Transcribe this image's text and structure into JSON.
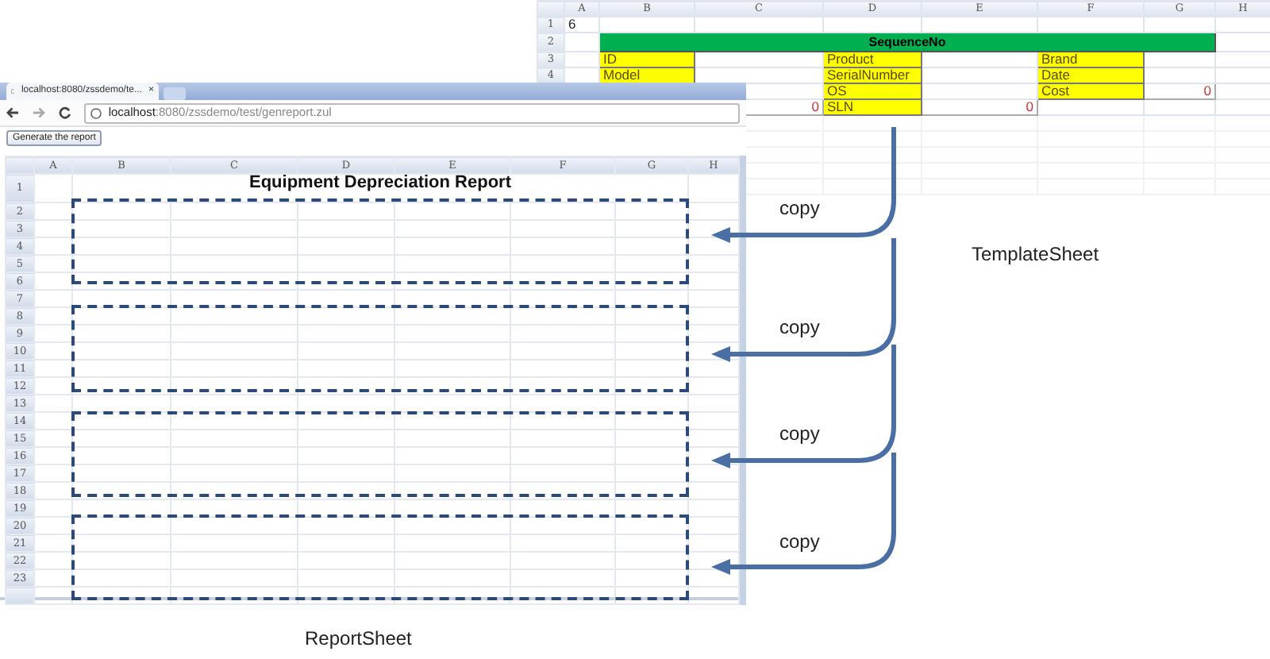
{
  "template_sheet": {
    "columns": [
      "A",
      "B",
      "C",
      "D",
      "E",
      "F",
      "G",
      "H"
    ],
    "rows": [
      {
        "label": "1",
        "cells": [
          {
            "text": "6",
            "kind": "plain"
          }
        ]
      },
      {
        "label": "2",
        "banner": "SequenceNo"
      },
      {
        "label": "3",
        "cells": [
          {},
          {
            "text": "ID",
            "kind": "label"
          },
          {},
          {
            "text": "Product",
            "kind": "label"
          },
          {},
          {
            "text": "Brand",
            "kind": "label"
          },
          {}
        ]
      },
      {
        "label": "4",
        "cells": [
          {},
          {
            "text": "Model",
            "kind": "label"
          },
          {},
          {
            "text": "SerialNumber",
            "kind": "label"
          },
          {},
          {
            "text": "Date",
            "kind": "label"
          },
          {}
        ]
      },
      {
        "cells": [
          {},
          {},
          {},
          {
            "text": "OS",
            "kind": "label"
          },
          {},
          {
            "text": "Cost",
            "kind": "label"
          },
          {
            "text": "0",
            "kind": "value"
          }
        ]
      },
      {
        "cells": [
          {},
          {},
          {
            "text": "0",
            "kind": "value"
          },
          {
            "text": "SLN",
            "kind": "label"
          },
          {
            "text": "0",
            "kind": "value"
          },
          {},
          {}
        ]
      }
    ],
    "caption": "TemplateSheet"
  },
  "browser": {
    "tab_title": "localhost:8080/zssdemo/te...",
    "tab_close": "×",
    "address": {
      "host": "localhost",
      "path": ":8080/zssdemo/test/genreport.zul"
    },
    "button": "Generate the report",
    "sheet": {
      "columns": [
        "A",
        "B",
        "C",
        "D",
        "E",
        "F",
        "G",
        "H"
      ],
      "rows": [
        "1",
        "2",
        "3",
        "4",
        "5",
        "6",
        "7",
        "8",
        "9",
        "10",
        "11",
        "12",
        "13",
        "14",
        "15",
        "16",
        "17",
        "18",
        "19",
        "20",
        "21",
        "22",
        "23"
      ],
      "title": "Equipment Depreciation Report"
    }
  },
  "copies": [
    {
      "label": "copy"
    },
    {
      "label": "copy"
    },
    {
      "label": "copy"
    },
    {
      "label": "copy"
    }
  ],
  "report_caption": "ReportSheet"
}
